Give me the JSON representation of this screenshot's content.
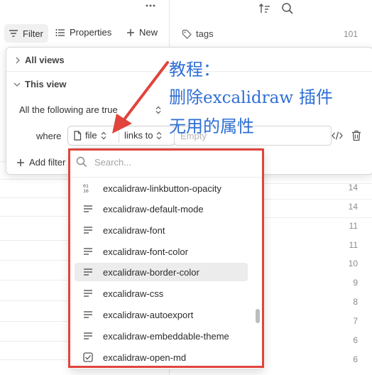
{
  "toolbar": {
    "more_icon": "more-horizontal-icon",
    "filter_label": "Filter",
    "properties_label": "Properties",
    "new_label": "New"
  },
  "right_header": {
    "tag_label": "tags",
    "tag_count": "101"
  },
  "popover": {
    "all_views_label": "All views",
    "this_view_label": "This view",
    "condition_label": "All the following are true",
    "where_label": "where",
    "property_value": "file",
    "operator_value": "links to",
    "value_placeholder": "Empty",
    "add_filter_label": "Add filter"
  },
  "dropdown": {
    "search_placeholder": "Search...",
    "items": [
      {
        "label": "excalidraw-linkbutton-opacity",
        "icon": "number-icon"
      },
      {
        "label": "excalidraw-default-mode",
        "icon": "text-icon"
      },
      {
        "label": "excalidraw-font",
        "icon": "text-icon"
      },
      {
        "label": "excalidraw-font-color",
        "icon": "text-icon"
      },
      {
        "label": "excalidraw-border-color",
        "icon": "text-icon"
      },
      {
        "label": "excalidraw-css",
        "icon": "text-icon"
      },
      {
        "label": "excalidraw-autoexport",
        "icon": "text-icon"
      },
      {
        "label": "excalidraw-embeddable-theme",
        "icon": "text-icon"
      },
      {
        "label": "excalidraw-open-md",
        "icon": "checkbox-icon"
      }
    ],
    "highlighted_index": 4
  },
  "counts": [
    "14",
    "14",
    "11",
    "11",
    "10",
    "9",
    "8",
    "7",
    "6",
    "6"
  ],
  "annotation": {
    "line1": "教程：",
    "line2a": "删除",
    "line2b": "excalidraw",
    "line2c": "插件",
    "line3": "无用的属性",
    "color": "#2f6fd4"
  },
  "colors": {
    "highlight_box": "#e0443c",
    "arrow": "#e0443c"
  }
}
